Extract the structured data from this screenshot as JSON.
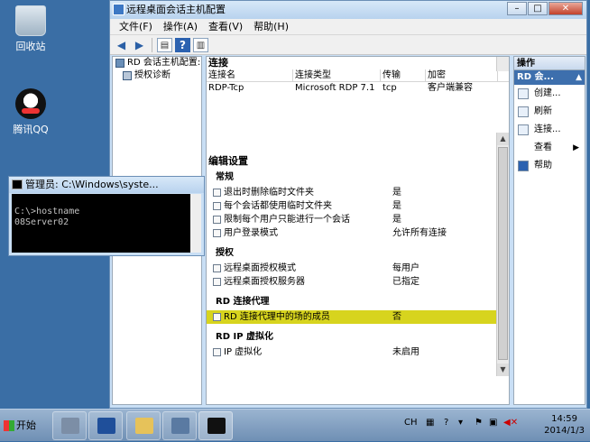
{
  "desktop": {
    "icons": [
      {
        "label": "回收站"
      },
      {
        "label": "腾讯QQ"
      }
    ]
  },
  "mmc": {
    "title": "远程桌面会话主机配置",
    "menu": [
      "文件(F)",
      "操作(A)",
      "查看(V)",
      "帮助(H)"
    ],
    "tree": [
      {
        "label": "RD 会话主机配置:"
      },
      {
        "label": "授权诊断"
      }
    ],
    "connections": {
      "title": "连接",
      "headers": [
        "连接名",
        "连接类型",
        "传输",
        "加密"
      ],
      "rows": [
        [
          "RDP-Tcp",
          "Microsoft RDP 7.1",
          "tcp",
          "客户端兼容"
        ]
      ]
    },
    "settings": {
      "title": "编辑设置",
      "groups": [
        {
          "title": "常规",
          "items": [
            {
              "name": "退出时删除临时文件夹",
              "value": "是"
            },
            {
              "name": "每个会话都使用临时文件夹",
              "value": "是"
            },
            {
              "name": "限制每个用户只能进行一个会话",
              "value": "是"
            },
            {
              "name": "用户登录模式",
              "value": "允许所有连接"
            }
          ]
        },
        {
          "title": "授权",
          "items": [
            {
              "name": "远程桌面授权模式",
              "value": "每用户"
            },
            {
              "name": "远程桌面授权服务器",
              "value": "已指定"
            }
          ]
        },
        {
          "title": "RD 连接代理",
          "items": [
            {
              "name": "RD 连接代理中的场的成员",
              "value": "否"
            }
          ]
        },
        {
          "title": "RD IP 虚拟化",
          "items": [
            {
              "name": "IP 虚拟化",
              "value": "未启用"
            }
          ]
        }
      ]
    },
    "actions": {
      "title": "操作",
      "subheader": "RD 会...",
      "items": [
        {
          "label": "创建..."
        },
        {
          "label": "刷新"
        },
        {
          "label": "连接..."
        },
        {
          "label": "查看"
        },
        {
          "label": "帮助"
        }
      ]
    }
  },
  "cmd": {
    "title": "管理员: C:\\Windows\\syste...",
    "lines": [
      "",
      "C:\\>hostname",
      "08Server02"
    ]
  },
  "taskbar": {
    "start_label": "开始",
    "lang": "CH",
    "time": "14:59",
    "date": "2014/1/3"
  },
  "colors": {
    "highlight": "#d7d41e",
    "desktop": "#3a6ea5",
    "action_subheader": "#3d6fad"
  }
}
